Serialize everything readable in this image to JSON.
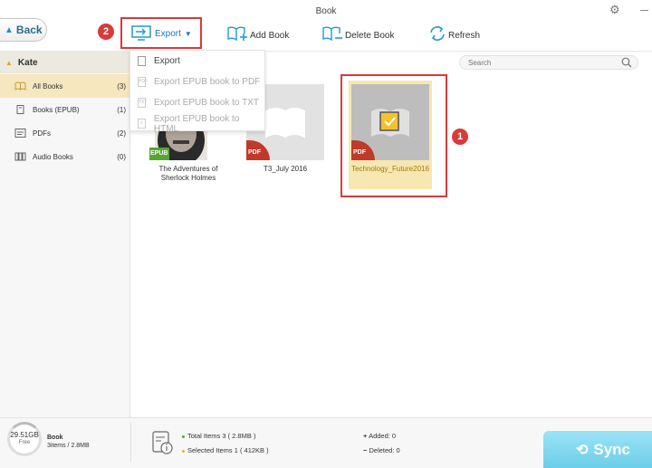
{
  "window": {
    "title": "Book"
  },
  "toolbar": {
    "back_label": "Back",
    "export_label": "Export",
    "add_label": "Add Book",
    "delete_label": "Delete Book",
    "refresh_label": "Refresh"
  },
  "markers": {
    "export": "2",
    "selected_book": "1"
  },
  "export_menu": {
    "items": [
      {
        "label": "Export",
        "icon": "file-icon"
      },
      {
        "label": "Export EPUB book to PDF",
        "icon": "pdf-file-icon"
      },
      {
        "label": "Export EPUB book to TXT",
        "icon": "txt-file-icon"
      },
      {
        "label": "Export EPUB book to HTML",
        "icon": "html-file-icon"
      }
    ]
  },
  "sidebar": {
    "device": "Kate",
    "items": [
      {
        "label": "All Books",
        "count": "(3)"
      },
      {
        "label": "Books (EPUB)",
        "count": "(1)"
      },
      {
        "label": "PDFs",
        "count": "(2)"
      },
      {
        "label": "Audio Books",
        "count": "(0)"
      }
    ]
  },
  "search": {
    "placeholder": "Search"
  },
  "books": [
    {
      "title": "The Adventures of Sherlock Holmes",
      "badge": "EPUB"
    },
    {
      "title": "T3_July 2016",
      "badge": "PDF"
    },
    {
      "title": "Technology_Future2016",
      "badge": "PDF",
      "selected": true
    }
  ],
  "status": {
    "storage_free": "29.51GB",
    "free_label": "Free",
    "category": "Book",
    "category_items": "3items / 2.8MB",
    "total_items": "Total Items 3 ( 2.8MB )",
    "selected_items": "Selected Items 1 ( 412KB )",
    "added": "Added: 0",
    "deleted": "Deleted: 0",
    "sync_label": "Sync"
  },
  "colors": {
    "accent_red": "#d93a3a",
    "link_blue": "#1f72b8",
    "selected_bg": "#f7e7b0"
  }
}
